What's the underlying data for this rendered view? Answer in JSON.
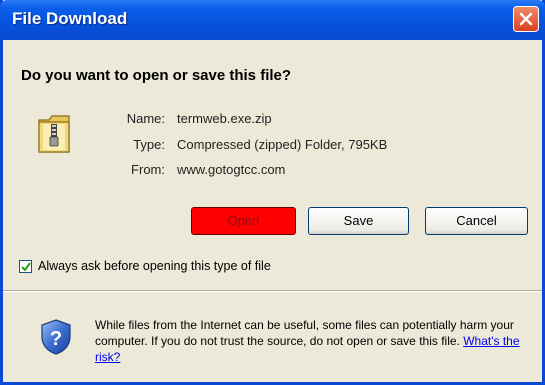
{
  "window": {
    "title": "File Download"
  },
  "question": "Do you want to open or save this file?",
  "file": {
    "name_label": "Name:",
    "name_value": "termweb.exe.zip",
    "type_label": "Type:",
    "type_value": "Compressed (zipped) Folder, 795KB",
    "from_label": "From:",
    "from_value": "www.gotogtcc.com"
  },
  "buttons": {
    "open": "Open",
    "save": "Save",
    "cancel": "Cancel"
  },
  "checkbox": {
    "label": "Always ask before opening this type of file",
    "checked": true
  },
  "warning": {
    "text": "While files from the Internet can be useful, some files can potentially harm your computer. If you do not trust the source, do not open or save this file.",
    "link": "What's the risk?"
  },
  "icons": {
    "folder": "zip-folder-icon",
    "shield": "shield-question-icon",
    "close": "close-icon"
  },
  "colors": {
    "titlebar": "#0651dd",
    "dialog_bg": "#ece9d8",
    "open_button": "#ff0000",
    "close_button": "#d8401f"
  }
}
